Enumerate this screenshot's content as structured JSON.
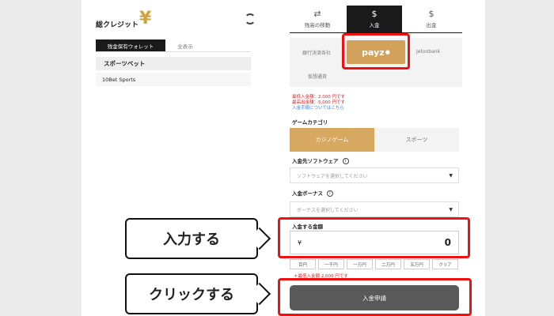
{
  "left": {
    "credit_title": "総クレジット",
    "yen": "¥",
    "wallet_tabs": [
      "残金保有ウォレット",
      "全表示"
    ],
    "sports_header": "スポーツベット",
    "sports_row": "10Bet Sports"
  },
  "tabs": [
    {
      "icon": "⇄",
      "label": "残高の移動"
    },
    {
      "icon": "$",
      "label": "入金"
    },
    {
      "icon": "$",
      "label": "出金"
    }
  ],
  "methods": {
    "bank": "銀行決済各社",
    "payz": "payz",
    "jetonbank": "Jetonbank",
    "crypto": "仮想通貨"
  },
  "notes": {
    "min": "最低入金額：2,000 円です",
    "max": "最高出金額：5,000 円です",
    "link": "入金手順についてはこちら"
  },
  "game_category": {
    "label": "ゲームカテゴリ",
    "options": [
      "カジノゲーム",
      "スポーツ"
    ]
  },
  "software": {
    "label": "入金先ソフトウェア",
    "placeholder": "ソフトウェアを選択してください"
  },
  "bonus": {
    "label": "入金ボーナス",
    "placeholder": "ボーナスを選択してください"
  },
  "amount": {
    "label": "入金する金額",
    "currency": "¥",
    "value": "0"
  },
  "quick_amounts": [
    "百円",
    "一千円",
    "一万円",
    "二万円",
    "五万円",
    "クリア"
  ],
  "min_note": "＊最低入金額 2,000 円です",
  "submit_label": "入金申請",
  "callouts": {
    "input": "入力する",
    "click": "クリックする"
  },
  "colors": {
    "accent": "#d2a25a",
    "highlight": "#e11111",
    "submit": "#595959"
  }
}
